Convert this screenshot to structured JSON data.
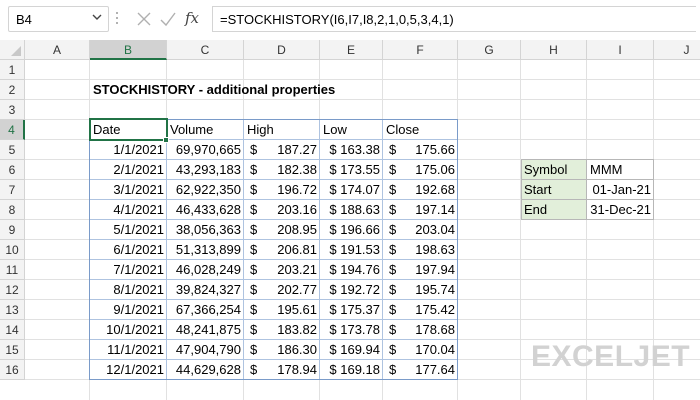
{
  "name_box": "B4",
  "formula": "=STOCKHISTORY(I6,I7,I8,2,1,0,5,3,4,1)",
  "fx_label": "fx",
  "columns": [
    "A",
    "B",
    "C",
    "D",
    "E",
    "F",
    "G",
    "H",
    "I",
    "J"
  ],
  "rows": [
    "1",
    "2",
    "3",
    "4",
    "5",
    "6",
    "7",
    "8",
    "9",
    "10",
    "11",
    "12",
    "13",
    "14",
    "15",
    "16"
  ],
  "title": "STOCKHISTORY - additional properties",
  "table": {
    "headers": [
      "Date",
      "Volume",
      "High",
      "Low",
      "Close"
    ],
    "currency_symbol": "$",
    "rows": [
      {
        "date": "1/1/2021",
        "volume": "69,970,665",
        "high": "187.27",
        "low": "$ 163.38",
        "close": "175.66"
      },
      {
        "date": "2/1/2021",
        "volume": "43,293,183",
        "high": "182.38",
        "low": "$ 173.55",
        "close": "175.06"
      },
      {
        "date": "3/1/2021",
        "volume": "62,922,350",
        "high": "196.72",
        "low": "$ 174.07",
        "close": "192.68"
      },
      {
        "date": "4/1/2021",
        "volume": "46,433,628",
        "high": "203.16",
        "low": "$ 188.63",
        "close": "197.14"
      },
      {
        "date": "5/1/2021",
        "volume": "38,056,363",
        "high": "208.95",
        "low": "$ 196.66",
        "close": "203.04"
      },
      {
        "date": "6/1/2021",
        "volume": "51,313,899",
        "high": "206.81",
        "low": "$ 191.53",
        "close": "198.63"
      },
      {
        "date": "7/1/2021",
        "volume": "46,028,249",
        "high": "203.21",
        "low": "$ 194.76",
        "close": "197.94"
      },
      {
        "date": "8/1/2021",
        "volume": "39,824,327",
        "high": "202.77",
        "low": "$ 192.72",
        "close": "195.74"
      },
      {
        "date": "9/1/2021",
        "volume": "67,366,254",
        "high": "195.61",
        "low": "$ 175.37",
        "close": "175.42"
      },
      {
        "date": "10/1/2021",
        "volume": "48,241,875",
        "high": "183.82",
        "low": "$ 173.78",
        "close": "178.68"
      },
      {
        "date": "11/1/2021",
        "volume": "47,904,790",
        "high": "186.30",
        "low": "$ 169.94",
        "close": "170.04"
      },
      {
        "date": "12/1/2021",
        "volume": "44,629,628",
        "high": "178.94",
        "low": "$ 169.18",
        "close": "177.64"
      }
    ]
  },
  "params": {
    "symbol_label": "Symbol",
    "symbol_value": "MMM",
    "start_label": "Start",
    "start_value": "01-Jan-21",
    "end_label": "End",
    "end_value": "31-Dec-21"
  },
  "logo_text": "EXCELJET",
  "colors": {
    "accent": "#217346",
    "table_border": "#7a9bc9",
    "param_header_bg": "#e2efda"
  }
}
